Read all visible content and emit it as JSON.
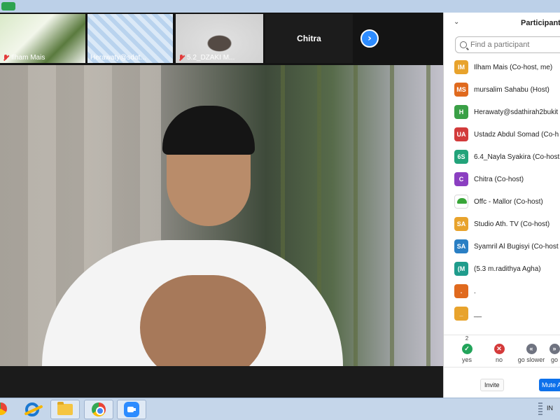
{
  "thumbnails": [
    {
      "name": "Ilham Mais",
      "muted": true
    },
    {
      "name": "Herawaty@sdat...",
      "muted": false
    },
    {
      "name": "5.2_DZAKI M...",
      "muted": true
    },
    {
      "name": "Chitra",
      "muted": false
    }
  ],
  "participants_panel": {
    "title": "Participants",
    "search_placeholder": "Find a participant",
    "participants": [
      {
        "initials": "IM",
        "color": "#e8a32c",
        "name": "Ilham Mais (Co-host, me)"
      },
      {
        "initials": "MS",
        "color": "#e06a1e",
        "name": "mursalim Sahabu (Host)"
      },
      {
        "initials": "H",
        "color": "#3aa046",
        "name": "Herawaty@sdathirah2bukit"
      },
      {
        "initials": "UA",
        "color": "#d23b3b",
        "name": "Ustadz Abdul Somad (Co-h"
      },
      {
        "initials": "6S",
        "color": "#22a37a",
        "name": "6.4_Nayla Syakira (Co-host"
      },
      {
        "initials": "C",
        "color": "#8b3fc1",
        "name": "Chitra (Co-host)"
      },
      {
        "initials": "",
        "color": "logo",
        "name": "Offc - Mallor (Co-host)"
      },
      {
        "initials": "SA",
        "color": "#e8a32c",
        "name": "Studio Ath. TV (Co-host)"
      },
      {
        "initials": "SA",
        "color": "#2a7fc4",
        "name": "Syamril Al Bugisyi (Co-host"
      },
      {
        "initials": "(M",
        "color": "#1f9c8c",
        "name": "(5.3 m.radithya Agha)"
      },
      {
        "initials": ".",
        "color": "#e06a1e",
        "name": "."
      },
      {
        "initials": "_",
        "color": "#e8a32c",
        "name": "__"
      }
    ],
    "reactions": [
      {
        "label": "yes",
        "count": "2",
        "symbol": "✓"
      },
      {
        "label": "no",
        "count": "",
        "symbol": "✕"
      },
      {
        "label": "go slower",
        "count": "",
        "symbol": "«"
      },
      {
        "label": "go",
        "count": "",
        "symbol": "»"
      }
    ],
    "invite_label": "Invite",
    "mute_all_label": "Mute All"
  },
  "taskbar": {
    "language": "IN",
    "apps": [
      "internet-explorer",
      "file-explorer",
      "chrome",
      "zoom"
    ]
  }
}
